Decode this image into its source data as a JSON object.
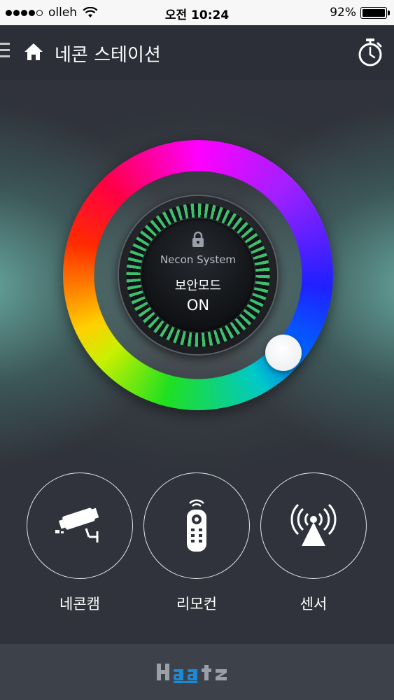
{
  "status_bar": {
    "carrier": "olleh",
    "time": "오전 10:24",
    "battery_percent": "92%",
    "signal_bars_filled": 4,
    "signal_bars_total": 5,
    "battery_level": 0.92
  },
  "header": {
    "title": "네콘 스테이션",
    "icons": [
      "menu-icon",
      "home-icon",
      "timer-icon"
    ]
  },
  "dial": {
    "system_label": "Necon System",
    "mode_label": "보안모드",
    "state_label": "ON",
    "icons": [
      "lock-icon"
    ]
  },
  "features": [
    {
      "label": "네콘캠",
      "icon": "cctv-camera-icon"
    },
    {
      "label": "리모컨",
      "icon": "remote-control-icon"
    },
    {
      "label": "센서",
      "icon": "sensor-icon"
    }
  ],
  "footer": {
    "brand": "Haatz"
  },
  "colors": {
    "background": "#2f323a",
    "header": "#2c2f37",
    "footer": "#3d414a",
    "ring_accent": "#3ec06a",
    "brand_blue": "#1a8ad8",
    "brand_gray": "#9aa0a8"
  }
}
